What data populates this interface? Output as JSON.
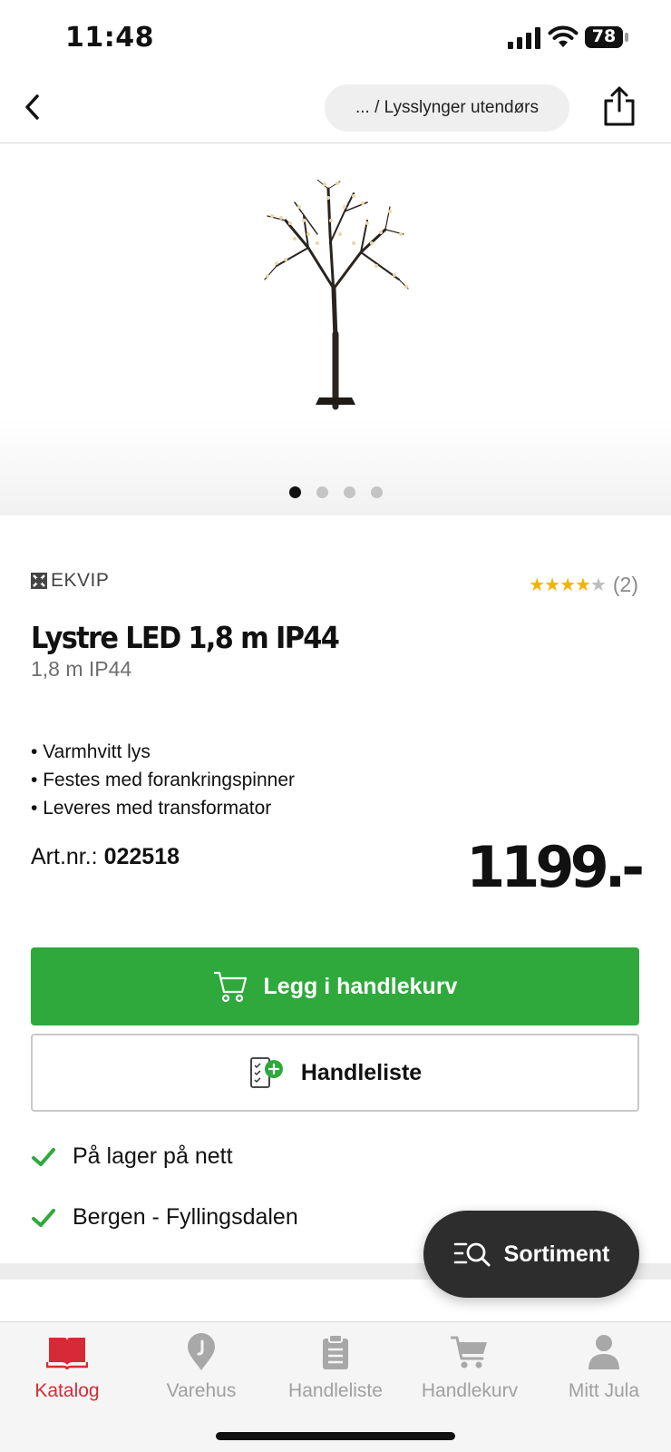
{
  "status_bar": {
    "time": "11:48",
    "battery": "78"
  },
  "header": {
    "breadcrumb": "... / Lysslynger utendørs"
  },
  "gallery": {
    "images": 4,
    "active_index": 0
  },
  "product": {
    "brand": "EKVIP",
    "rating": {
      "stars": 4,
      "max": 5,
      "count": "(2)"
    },
    "title": "Lystre LED 1,8 m IP44",
    "subtitle": "1,8 m IP44",
    "features": [
      "Varmhvitt lys",
      "Festes med forankringspinner",
      "Leveres med transformator"
    ],
    "art_label": "Art.nr.:",
    "art_number": "022518",
    "price": "1199.-"
  },
  "actions": {
    "add_to_cart": "Legg i handlekurv",
    "shopping_list": "Handleliste"
  },
  "stock": [
    "På lager på nett",
    "Bergen - Fyllingsdalen"
  ],
  "fab": {
    "label": "Sortiment"
  },
  "tabs": [
    {
      "label": "Katalog",
      "icon": "catalog-icon",
      "active": true
    },
    {
      "label": "Varehus",
      "icon": "location-pin-icon",
      "active": false
    },
    {
      "label": "Handleliste",
      "icon": "clipboard-icon",
      "active": false
    },
    {
      "label": "Handlekurv",
      "icon": "cart-icon",
      "active": false
    },
    {
      "label": "Mitt Jula",
      "icon": "person-icon",
      "active": false
    }
  ],
  "colors": {
    "accent_green": "#2fa93c",
    "active_red": "#d62b36",
    "star": "#f5b301",
    "fab_dark": "#2d2d2d"
  }
}
